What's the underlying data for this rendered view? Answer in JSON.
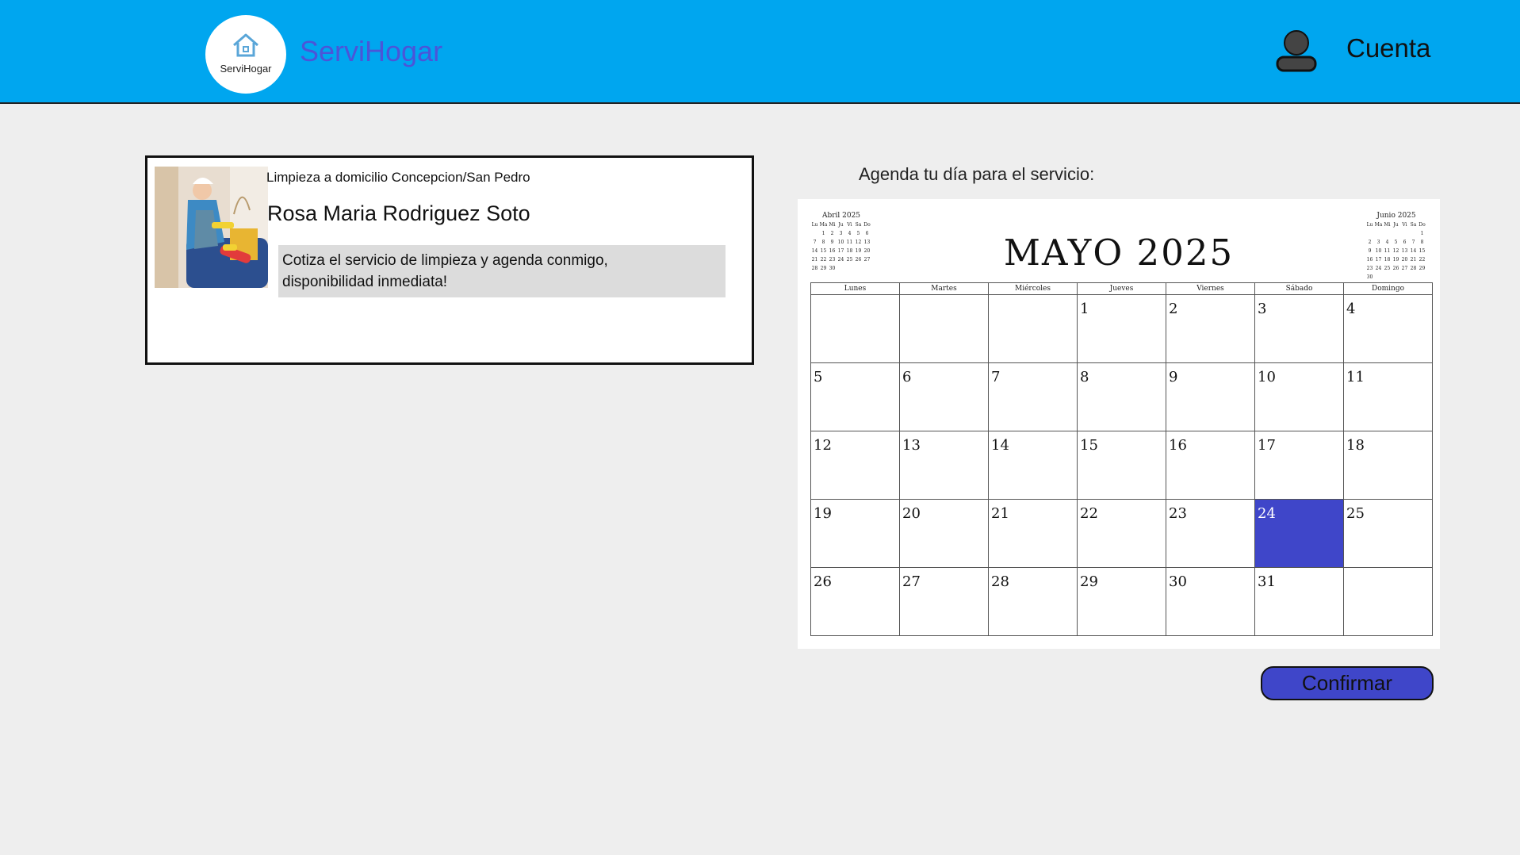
{
  "header": {
    "logo_text": "ServiHogar",
    "brand": "ServiHogar",
    "account_label": "Cuenta"
  },
  "service_card": {
    "category": "Limpieza a domicilio Concepcion/San Pedro",
    "provider_name": "Rosa Maria Rodriguez Soto",
    "description_line1": "Cotiza el servicio de limpieza y agenda conmigo,",
    "description_line2": "disponibilidad inmediata!"
  },
  "agenda": {
    "title": "Agenda tu día para el servicio:",
    "month_title": "MAYO 2025",
    "weekdays": [
      "Lunes",
      "Martes",
      "Miércoles",
      "Jueves",
      "Viernes",
      "Sábado",
      "Domingo"
    ],
    "days": [
      "",
      "",
      "",
      "1",
      "2",
      "3",
      "4",
      "5",
      "6",
      "7",
      "8",
      "9",
      "10",
      "11",
      "12",
      "13",
      "14",
      "15",
      "16",
      "17",
      "18",
      "19",
      "20",
      "21",
      "22",
      "23",
      "24",
      "25",
      "26",
      "27",
      "28",
      "29",
      "30",
      "31",
      ""
    ],
    "selected_day": "24",
    "prev_month": {
      "title": "Abril 2025",
      "header": [
        "Lu",
        "Ma",
        "Mi",
        "Ju",
        "Vi",
        "Sa",
        "Do"
      ],
      "days": [
        "",
        "1",
        "2",
        "3",
        "4",
        "5",
        "6",
        "7",
        "8",
        "9",
        "10",
        "11",
        "12",
        "13",
        "14",
        "15",
        "16",
        "17",
        "18",
        "19",
        "20",
        "21",
        "22",
        "23",
        "24",
        "25",
        "26",
        "27",
        "28",
        "29",
        "30",
        "",
        "",
        "",
        ""
      ]
    },
    "next_month": {
      "title": "Junio 2025",
      "header": [
        "Lu",
        "Ma",
        "Mi",
        "Ju",
        "Vi",
        "Sa",
        "Do"
      ],
      "days": [
        "",
        "",
        "",
        "",
        "",
        "",
        "1",
        "2",
        "3",
        "4",
        "5",
        "6",
        "7",
        "8",
        "9",
        "10",
        "11",
        "12",
        "13",
        "14",
        "15",
        "16",
        "17",
        "18",
        "19",
        "20",
        "21",
        "22",
        "23",
        "24",
        "25",
        "26",
        "27",
        "28",
        "29",
        "30",
        "",
        "",
        "",
        "",
        "",
        ""
      ]
    },
    "confirm_label": "Confirmar"
  },
  "colors": {
    "header_bg": "#00a6ef",
    "brand": "#4b55d8",
    "accent": "#3f46c9"
  }
}
